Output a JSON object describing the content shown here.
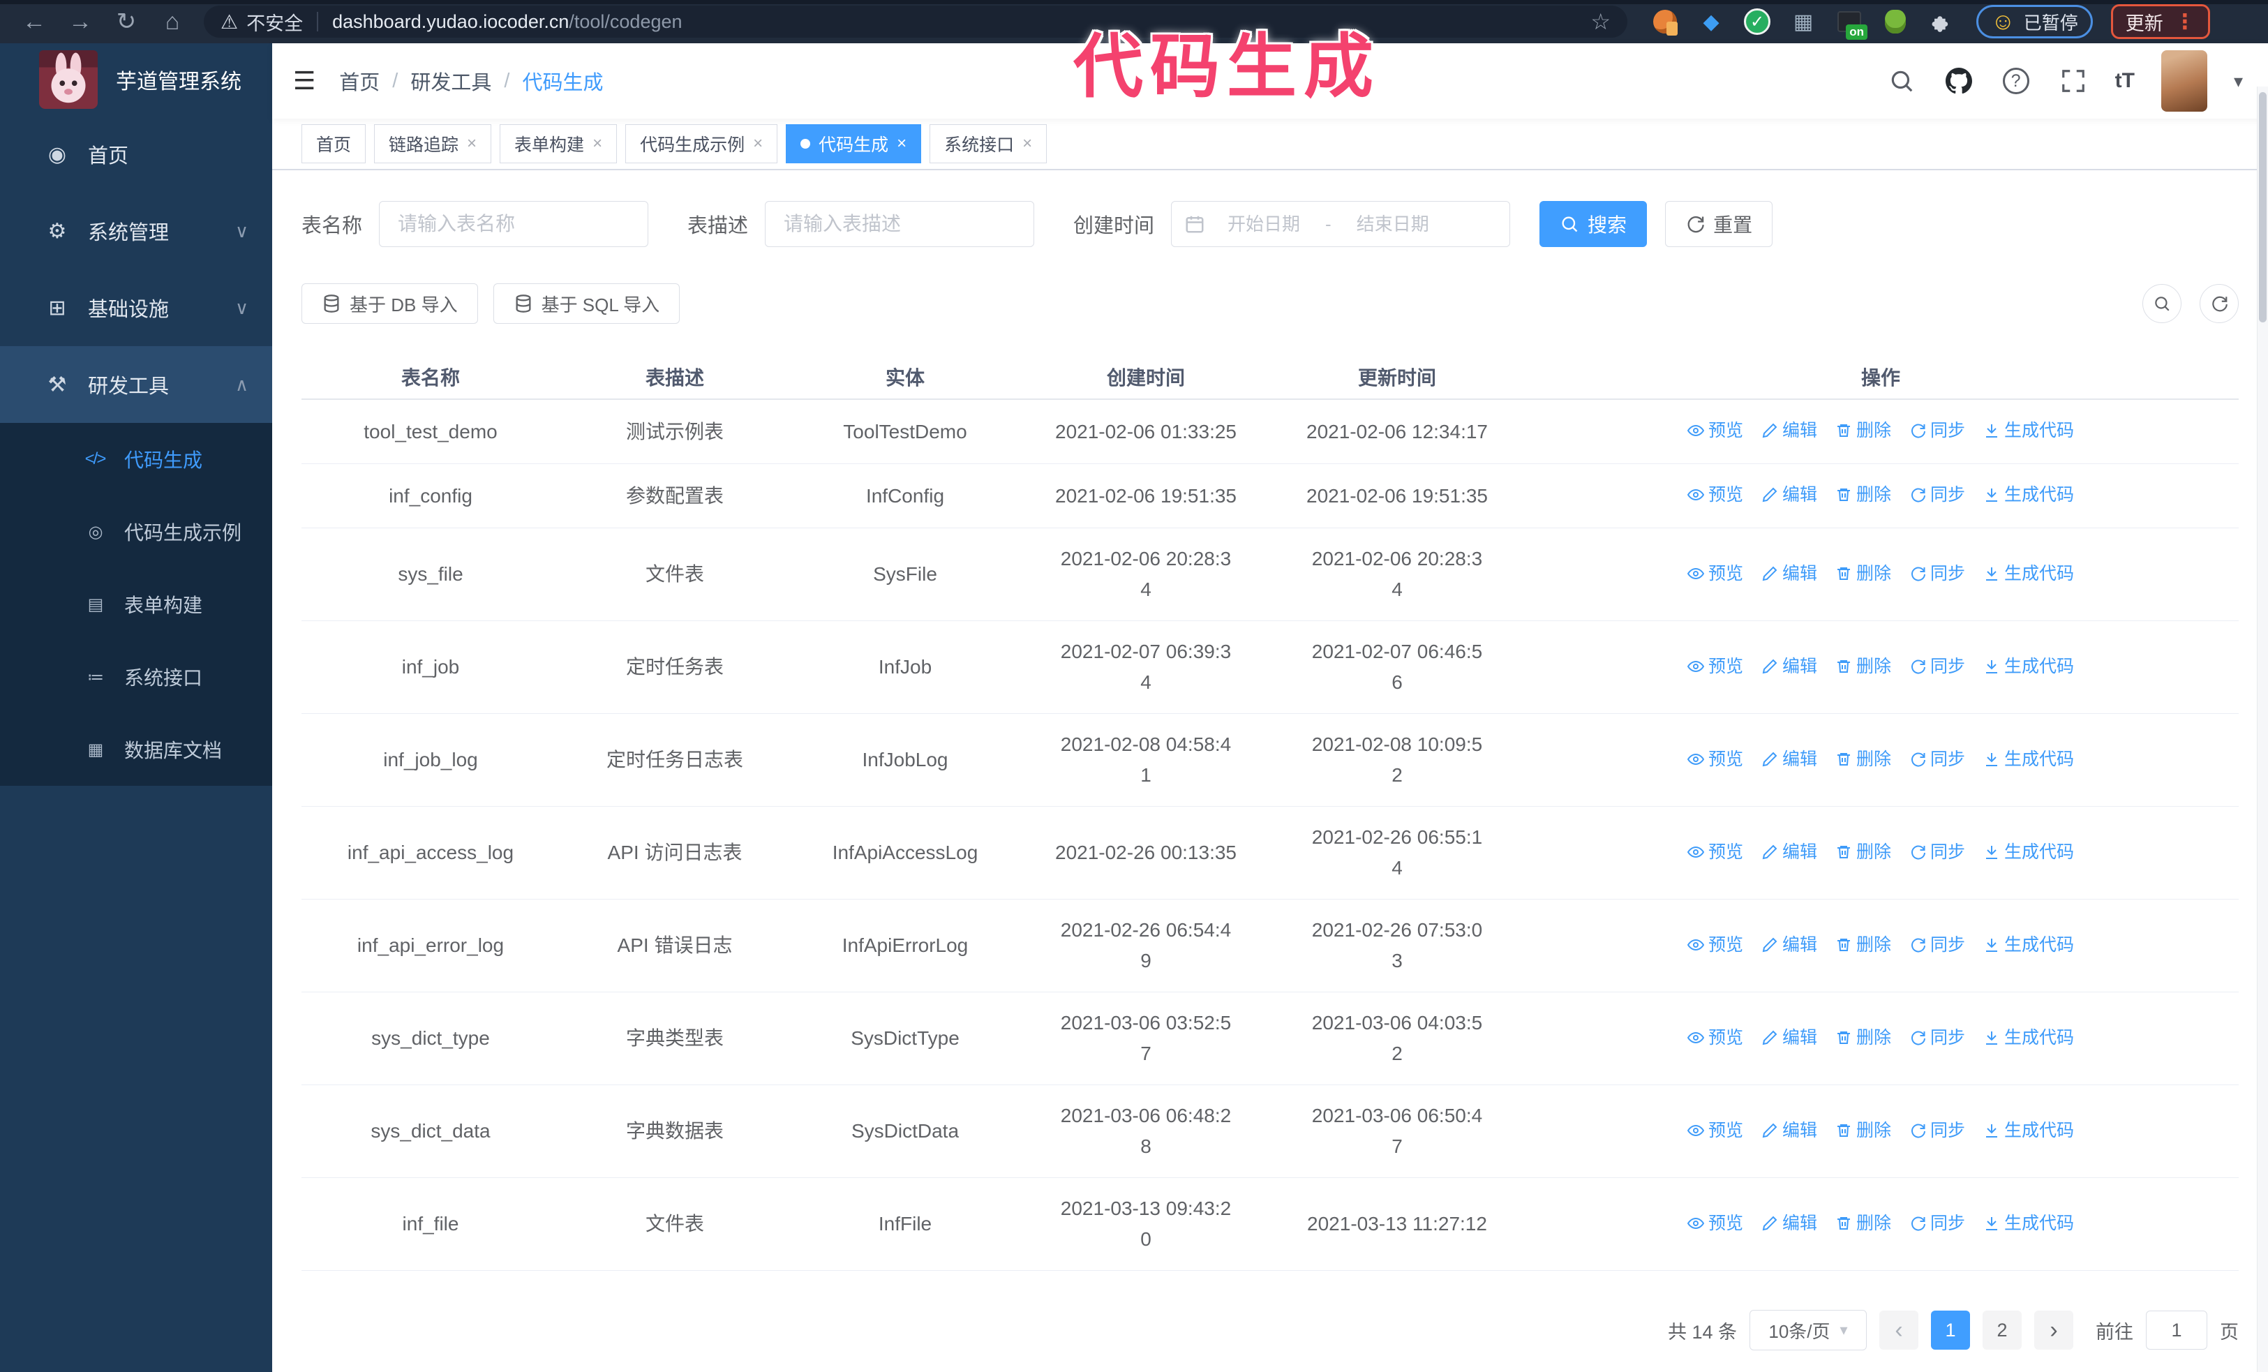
{
  "colors": {
    "accent": "#409eff",
    "annotation_pink": "#f4426e",
    "sidebar_bg": "#1e3a57",
    "submenu_bg": "#14293f"
  },
  "annotation": {
    "text": "代码生成"
  },
  "browser": {
    "security_label": "不安全",
    "url_host": "dashboard.yudao.iocoder.cn",
    "url_path": "/tool/codegen",
    "on_badge": "on",
    "paused_badge": "已暂停",
    "update_button": "更新"
  },
  "icons": {
    "back-arrow": "←",
    "forward-arrow": "→",
    "reload": "↻",
    "home": "⌂",
    "warning": "⚠",
    "star": "☆",
    "more-dots": "⋮",
    "face": "☺",
    "blue-gem": "◆",
    "check": "✓",
    "grid": "▦",
    "hamburger": "☰",
    "caret-down": "▾",
    "font-size": "tT",
    "question": "?",
    "chevron-down": "∨",
    "chevron-up": "∧",
    "dashboard": "◉",
    "gear": "⚙",
    "infra": "⊞",
    "toolbox": "⚒",
    "code": "</>",
    "example": "◎",
    "form": "▤",
    "api": "≔",
    "dbdoc": "▦",
    "prev": "‹",
    "next": "›",
    "close": "×",
    "dot": "●",
    "select-caret": "▾"
  },
  "sidebar": {
    "title": "芋道管理系统",
    "menu": [
      {
        "label": "首页",
        "icon": "dashboard",
        "expandable": false,
        "expanded": false
      },
      {
        "label": "系统管理",
        "icon": "gear",
        "expandable": true,
        "expanded": false
      },
      {
        "label": "基础设施",
        "icon": "infra",
        "expandable": true,
        "expanded": false
      },
      {
        "label": "研发工具",
        "icon": "toolbox",
        "expandable": true,
        "expanded": true
      }
    ],
    "submenu": [
      {
        "label": "代码生成",
        "icon": "code",
        "active": true
      },
      {
        "label": "代码生成示例",
        "icon": "example",
        "active": false
      },
      {
        "label": "表单构建",
        "icon": "form",
        "active": false
      },
      {
        "label": "系统接口",
        "icon": "api",
        "active": false
      },
      {
        "label": "数据库文档",
        "icon": "dbdoc",
        "active": false
      }
    ]
  },
  "header": {
    "breadcrumb": [
      "首页",
      "研发工具",
      "代码生成"
    ],
    "separator": "/"
  },
  "tabs": [
    {
      "label": "首页",
      "closable": false,
      "active": false
    },
    {
      "label": "链路追踪",
      "closable": true,
      "active": false
    },
    {
      "label": "表单构建",
      "closable": true,
      "active": false
    },
    {
      "label": "代码生成示例",
      "closable": true,
      "active": false
    },
    {
      "label": "代码生成",
      "closable": true,
      "active": true
    },
    {
      "label": "系统接口",
      "closable": true,
      "active": false
    }
  ],
  "search": {
    "name_label": "表名称",
    "name_placeholder": "请输入表名称",
    "desc_label": "表描述",
    "desc_placeholder": "请输入表描述",
    "time_label": "创建时间",
    "start_placeholder": "开始日期",
    "separator": "-",
    "end_placeholder": "结束日期",
    "search_button": "搜索",
    "reset_button": "重置"
  },
  "toolbar": {
    "import_db": "基于 DB 导入",
    "import_sql": "基于 SQL 导入"
  },
  "table": {
    "columns": [
      "表名称",
      "表描述",
      "实体",
      "创建时间",
      "更新时间",
      "操作"
    ],
    "actions": [
      {
        "label": "预览",
        "icon": "eye-icon"
      },
      {
        "label": "编辑",
        "icon": "edit-icon"
      },
      {
        "label": "删除",
        "icon": "delete-icon"
      },
      {
        "label": "同步",
        "icon": "sync-icon"
      },
      {
        "label": "生成代码",
        "icon": "download-icon"
      }
    ],
    "rows": [
      {
        "name": "tool_test_demo",
        "desc": "测试示例表",
        "entity": "ToolTestDemo",
        "created": "2021-02-06 01:33:25",
        "updated": "2021-02-06 12:34:17"
      },
      {
        "name": "inf_config",
        "desc": "参数配置表",
        "entity": "InfConfig",
        "created": "2021-02-06 19:51:35",
        "updated": "2021-02-06 19:51:35"
      },
      {
        "name": "sys_file",
        "desc": "文件表",
        "entity": "SysFile",
        "created": "2021-02-06 20:28:3\n4",
        "updated": "2021-02-06 20:28:3\n4"
      },
      {
        "name": "inf_job",
        "desc": "定时任务表",
        "entity": "InfJob",
        "created": "2021-02-07 06:39:3\n4",
        "updated": "2021-02-07 06:46:5\n6"
      },
      {
        "name": "inf_job_log",
        "desc": "定时任务日志表",
        "entity": "InfJobLog",
        "created": "2021-02-08 04:58:4\n1",
        "updated": "2021-02-08 10:09:5\n2"
      },
      {
        "name": "inf_api_access_log",
        "desc": "API 访问日志表",
        "entity": "InfApiAccessLog",
        "created": "2021-02-26 00:13:35",
        "updated": "2021-02-26 06:55:1\n4"
      },
      {
        "name": "inf_api_error_log",
        "desc": "API 错误日志",
        "entity": "InfApiErrorLog",
        "created": "2021-02-26 06:54:4\n9",
        "updated": "2021-02-26 07:53:0\n3"
      },
      {
        "name": "sys_dict_type",
        "desc": "字典类型表",
        "entity": "SysDictType",
        "created": "2021-03-06 03:52:5\n7",
        "updated": "2021-03-06 04:03:5\n2"
      },
      {
        "name": "sys_dict_data",
        "desc": "字典数据表",
        "entity": "SysDictData",
        "created": "2021-03-06 06:48:2\n8",
        "updated": "2021-03-06 06:50:4\n7"
      },
      {
        "name": "inf_file",
        "desc": "文件表",
        "entity": "InfFile",
        "created": "2021-03-13 09:43:2\n0",
        "updated": "2021-03-13 11:27:12"
      }
    ]
  },
  "pagination": {
    "total": "共 14 条",
    "page_size": "10条/页",
    "pages": [
      "1",
      "2"
    ],
    "active_page": "1",
    "goto_label": "前往",
    "goto_value": "1",
    "goto_suffix": "页"
  }
}
